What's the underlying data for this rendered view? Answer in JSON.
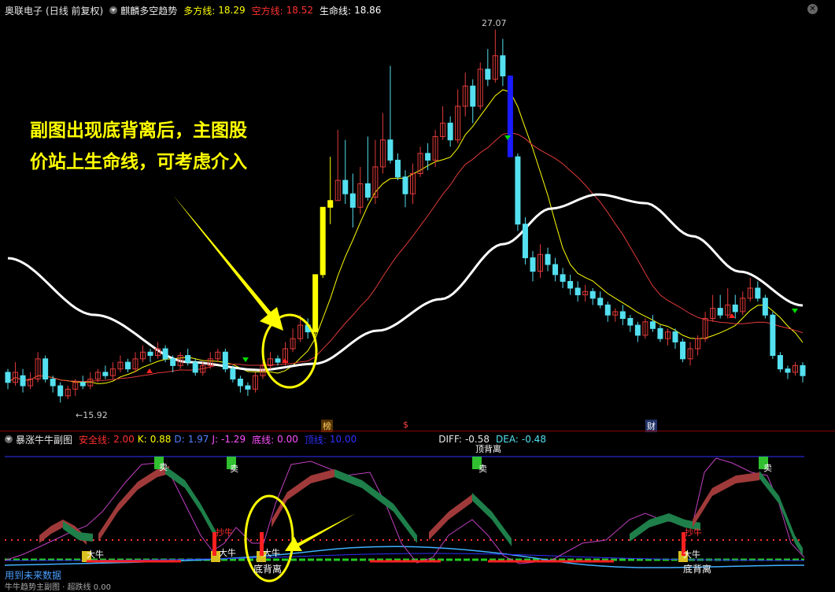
{
  "main_header": {
    "stock": "奥联电子",
    "period": "(日线 前复权)",
    "indicator": "麒麟多空趋势",
    "bull_label": "多方线:",
    "bull_value": "18.29",
    "bear_label": "空方线:",
    "bear_value": "18.52",
    "life_label": "生命线:",
    "life_value": "18.86",
    "close_icon": "close-icon"
  },
  "annotation_main": {
    "line1": "副图出现底背离后，主图股",
    "line2": "价站上生命线，可考虑介入"
  },
  "price_labels": {
    "high": "27.07",
    "low": "←15.92"
  },
  "bottom_markers": [
    "榜",
    "$",
    "财"
  ],
  "sub_header": {
    "indicator": "暴涨牛牛副图",
    "safe_label": "安全线:",
    "safe_value": "2.00",
    "k_label": "K:",
    "k_value": "0.88",
    "d_label": "D:",
    "d_value": "1.97",
    "j_label": "J:",
    "j_value": "-1.29",
    "bottom_label": "底线:",
    "bottom_value": "0.00",
    "top_label": "顶线:",
    "top_value": "10.00",
    "diff_label": "DIFF:",
    "diff_value": "-0.58",
    "dea_label": "DEA:",
    "dea_value": "-0.48"
  },
  "sub_labels": {
    "top_div": "顶背离",
    "sell": "卖",
    "buy_big": "大牛",
    "chase": "抄牛",
    "bottom_div": "底背离"
  },
  "sub_bottom_text": "用到未来数据",
  "sub_footer": "牛牛趋势主副图 · 超跌线 0.00",
  "colors": {
    "up": "#e23a3a",
    "down": "#54e0f0",
    "yellow": "#ffff00",
    "white": "#ffffff",
    "blue": "#1a1aff",
    "green": "#1e7f4a",
    "brown": "#a03a3a",
    "magenta": "#c040c0"
  },
  "chart_data": {
    "type": "candlestick",
    "price_max": 27.07,
    "price_min": 15.92,
    "candles": [
      [
        16.9,
        16.6,
        17.0,
        16.4
      ],
      [
        16.6,
        16.9,
        17.2,
        16.5
      ],
      [
        16.8,
        16.5,
        17.0,
        16.3
      ],
      [
        16.5,
        16.7,
        16.9,
        16.4
      ],
      [
        16.7,
        17.3,
        17.5,
        16.6
      ],
      [
        17.3,
        16.7,
        17.4,
        16.6
      ],
      [
        16.7,
        16.5,
        16.8,
        16.3
      ],
      [
        16.5,
        16.2,
        16.6,
        16.0
      ],
      [
        16.2,
        16.4,
        16.5,
        16.1
      ],
      [
        16.4,
        16.6,
        16.7,
        16.2
      ],
      [
        16.6,
        16.5,
        16.8,
        16.4
      ],
      [
        16.5,
        16.7,
        16.9,
        16.4
      ],
      [
        16.7,
        16.9,
        17.0,
        16.6
      ],
      [
        16.9,
        16.8,
        17.1,
        16.7
      ],
      [
        16.8,
        17.0,
        17.2,
        16.7
      ],
      [
        17.0,
        17.2,
        17.4,
        16.9
      ],
      [
        17.2,
        17.0,
        17.3,
        16.9
      ],
      [
        17.0,
        17.3,
        17.5,
        16.9
      ],
      [
        17.3,
        17.5,
        17.7,
        17.2
      ],
      [
        17.5,
        17.4,
        17.6,
        17.2
      ],
      [
        17.4,
        17.6,
        17.8,
        17.3
      ],
      [
        17.6,
        17.3,
        17.7,
        17.2
      ],
      [
        17.3,
        17.1,
        17.4,
        16.9
      ],
      [
        17.1,
        17.4,
        17.5,
        17.0
      ],
      [
        17.4,
        17.2,
        17.6,
        17.1
      ],
      [
        17.2,
        16.9,
        17.3,
        16.8
      ],
      [
        16.9,
        17.1,
        17.2,
        16.8
      ],
      [
        17.1,
        17.3,
        17.5,
        17.0
      ],
      [
        17.3,
        17.5,
        17.6,
        17.2
      ],
      [
        17.5,
        17.0,
        17.6,
        16.9
      ],
      [
        17.0,
        16.7,
        17.1,
        16.6
      ],
      [
        16.7,
        16.5,
        16.8,
        16.3
      ],
      [
        16.5,
        16.4,
        16.6,
        16.2
      ],
      [
        16.4,
        16.8,
        16.9,
        16.3
      ],
      [
        16.8,
        17.1,
        17.2,
        16.7
      ],
      [
        17.1,
        17.3,
        17.5,
        17.0
      ],
      [
        17.3,
        17.2,
        17.4,
        17.1
      ],
      [
        17.2,
        17.6,
        17.8,
        17.1
      ],
      [
        17.6,
        17.9,
        18.2,
        17.5
      ],
      [
        17.9,
        18.3,
        18.6,
        17.8
      ],
      [
        18.3,
        18.1,
        18.5,
        17.9
      ],
      [
        18.1,
        19.8,
        19.8,
        18.0
      ],
      [
        19.8,
        21.8,
        21.8,
        19.7
      ],
      [
        21.8,
        22.0,
        23.3,
        21.3
      ],
      [
        22.0,
        22.6,
        24.1,
        22.0
      ],
      [
        22.6,
        22.2,
        23.8,
        21.9
      ],
      [
        22.2,
        21.8,
        22.8,
        21.2
      ],
      [
        21.8,
        22.5,
        23.0,
        21.6
      ],
      [
        22.5,
        22.1,
        23.9,
        22.0
      ],
      [
        22.1,
        23.0,
        23.8,
        21.9
      ],
      [
        23.0,
        23.8,
        24.6,
        22.8
      ],
      [
        23.8,
        23.2,
        26.0,
        23.1
      ],
      [
        23.2,
        22.7,
        23.4,
        22.6
      ],
      [
        22.7,
        22.2,
        22.9,
        21.8
      ],
      [
        22.2,
        22.8,
        23.1,
        21.9
      ],
      [
        22.8,
        23.4,
        23.6,
        22.7
      ],
      [
        23.4,
        23.2,
        23.7,
        22.9
      ],
      [
        23.2,
        23.9,
        24.1,
        23.0
      ],
      [
        23.9,
        24.3,
        24.8,
        23.8
      ],
      [
        24.3,
        23.8,
        24.5,
        23.6
      ],
      [
        23.8,
        24.8,
        25.3,
        23.7
      ],
      [
        24.8,
        25.4,
        25.8,
        24.5
      ],
      [
        25.4,
        24.8,
        25.6,
        24.3
      ],
      [
        24.8,
        25.9,
        26.1,
        24.7
      ],
      [
        25.9,
        25.6,
        26.5,
        25.4
      ],
      [
        25.6,
        26.3,
        27.07,
        25.5
      ],
      [
        26.3,
        25.7,
        26.8,
        25.4
      ],
      [
        25.7,
        23.3,
        25.7,
        23.3
      ],
      [
        23.3,
        21.3,
        23.4,
        21.1
      ],
      [
        21.3,
        20.3,
        21.5,
        20.1
      ],
      [
        20.3,
        19.9,
        20.5,
        19.6
      ],
      [
        19.9,
        20.4,
        20.7,
        19.7
      ],
      [
        20.4,
        20.1,
        20.6,
        19.9
      ],
      [
        20.1,
        19.8,
        20.3,
        19.6
      ],
      [
        19.8,
        19.6,
        20.0,
        19.4
      ],
      [
        19.6,
        19.4,
        19.8,
        19.2
      ],
      [
        19.4,
        19.2,
        19.6,
        19.0
      ],
      [
        19.2,
        19.3,
        19.5,
        19.0
      ],
      [
        19.3,
        19.1,
        19.4,
        18.9
      ],
      [
        19.1,
        18.9,
        19.3,
        18.8
      ],
      [
        18.9,
        18.6,
        19.0,
        18.4
      ],
      [
        18.6,
        18.7,
        18.8,
        18.4
      ],
      [
        18.7,
        18.5,
        18.9,
        18.3
      ],
      [
        18.5,
        18.3,
        18.6,
        18.1
      ],
      [
        18.3,
        18.0,
        18.4,
        17.8
      ],
      [
        18.0,
        18.4,
        18.5,
        17.9
      ],
      [
        18.4,
        18.2,
        18.6,
        18.1
      ],
      [
        18.2,
        17.9,
        18.3,
        17.8
      ],
      [
        17.9,
        18.1,
        18.2,
        17.7
      ],
      [
        18.1,
        17.8,
        18.2,
        17.6
      ],
      [
        17.8,
        17.3,
        17.9,
        17.2
      ],
      [
        17.3,
        17.6,
        17.8,
        17.1
      ],
      [
        17.6,
        17.9,
        18.0,
        17.4
      ],
      [
        17.9,
        18.5,
        18.7,
        17.8
      ],
      [
        18.5,
        18.8,
        19.2,
        18.4
      ],
      [
        18.8,
        18.6,
        19.2,
        18.5
      ],
      [
        18.6,
        18.9,
        19.4,
        18.5
      ],
      [
        18.9,
        18.7,
        19.2,
        18.5
      ],
      [
        18.7,
        19.1,
        19.3,
        18.6
      ],
      [
        19.1,
        19.4,
        19.7,
        19.0
      ],
      [
        19.4,
        19.1,
        19.6,
        19.0
      ],
      [
        19.1,
        18.6,
        19.2,
        18.5
      ],
      [
        18.6,
        17.4,
        18.7,
        17.3
      ],
      [
        17.4,
        17.0,
        17.5,
        16.9
      ],
      [
        17.0,
        16.9,
        17.1,
        16.7
      ],
      [
        16.9,
        17.1,
        17.2,
        16.8
      ],
      [
        17.1,
        16.8,
        17.2,
        16.6
      ]
    ],
    "series": [
      {
        "name": "多方线",
        "color": "#ffff00"
      },
      {
        "name": "空方线",
        "color": "#e23a3a"
      },
      {
        "name": "生命线",
        "color": "#ffffff"
      }
    ]
  }
}
